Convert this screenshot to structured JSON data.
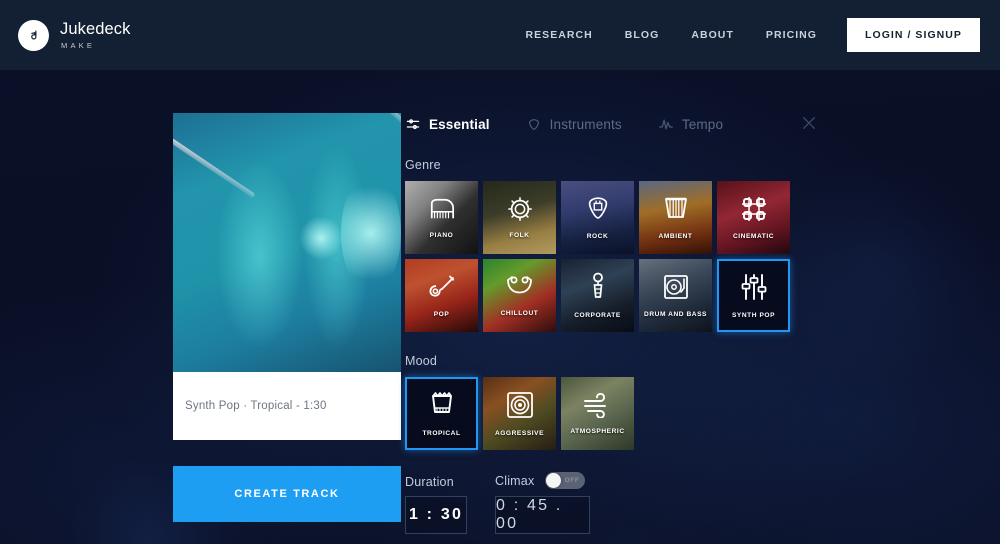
{
  "header": {
    "brand_name": "Jukedeck",
    "brand_sub": "MAKE",
    "logo_icon": "music-note-icon",
    "nav": [
      {
        "label": "RESEARCH",
        "name": "nav-research"
      },
      {
        "label": "BLOG",
        "name": "nav-blog"
      },
      {
        "label": "ABOUT",
        "name": "nav-about"
      },
      {
        "label": "PRICING",
        "name": "nav-pricing"
      }
    ],
    "login_label": "LOGIN / SIGNUP"
  },
  "preview": {
    "caption": "Synth Pop · Tropical - 1:30",
    "create_label": "CREATE TRACK",
    "image_alt": "stage-lights-photo"
  },
  "panel": {
    "tabs": [
      {
        "label": "Essential",
        "icon": "sliders-icon",
        "active": true
      },
      {
        "label": "Instruments",
        "icon": "guitar-pick-icon",
        "active": false
      },
      {
        "label": "Tempo",
        "icon": "waveform-icon",
        "active": false
      }
    ],
    "close_icon": "close-icon",
    "genre": {
      "title": "Genre",
      "tiles": [
        {
          "label": "PIANO",
          "icon": "grand-piano-icon",
          "bg": "bg-piano",
          "selected": false
        },
        {
          "label": "FOLK",
          "icon": "banjo-icon",
          "bg": "bg-folk",
          "selected": false
        },
        {
          "label": "ROCK",
          "icon": "guitar-pick-amp-icon",
          "bg": "bg-rock",
          "selected": false
        },
        {
          "label": "AMBIENT",
          "icon": "harp-icon",
          "bg": "bg-ambient",
          "selected": false
        },
        {
          "label": "CINEMATIC",
          "icon": "film-grid-icon",
          "bg": "bg-cinematic",
          "selected": false
        },
        {
          "label": "POP",
          "icon": "electric-guitar-icon",
          "bg": "bg-pop",
          "selected": false
        },
        {
          "label": "CHILLOUT",
          "icon": "hammock-icon",
          "bg": "bg-chillout",
          "selected": false
        },
        {
          "label": "CORPORATE",
          "icon": "microphone-icon",
          "bg": "bg-corporate",
          "selected": false
        },
        {
          "label": "DRUM AND BASS",
          "icon": "turntable-icon",
          "bg": "bg-dnb",
          "selected": false
        },
        {
          "label": "SYNTH POP",
          "icon": "faders-icon",
          "bg": "bg-synthpop",
          "selected": true
        }
      ]
    },
    "mood": {
      "title": "Mood",
      "tiles": [
        {
          "label": "TROPICAL",
          "icon": "bongo-drum-icon",
          "bg": "bg-tropical",
          "selected": true
        },
        {
          "label": "AGGRESSIVE",
          "icon": "speaker-icon",
          "bg": "bg-aggressive",
          "selected": false
        },
        {
          "label": "ATMOSPHERIC",
          "icon": "wind-icon",
          "bg": "bg-atmospheric",
          "selected": false
        }
      ]
    },
    "duration": {
      "label": "Duration",
      "value": "1 : 30"
    },
    "climax": {
      "label": "Climax",
      "value": "0 : 45 . 00",
      "toggle_state": "OFF",
      "toggle_on": false
    }
  },
  "colors": {
    "accent_blue": "#1e9ef2",
    "selection_blue": "#2196f3",
    "header_bg": "#131f32",
    "page_bg": "#0a0f26"
  }
}
